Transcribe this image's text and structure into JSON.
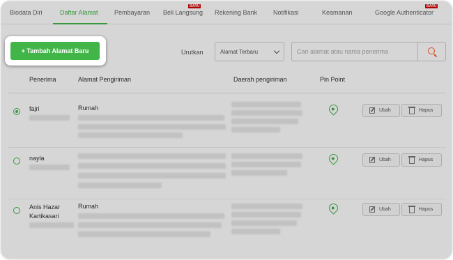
{
  "tabs": [
    {
      "label": "Biodata Diri",
      "active": false
    },
    {
      "label": "Daftar Alamat",
      "active": true
    },
    {
      "label": "Pembayaran",
      "active": false
    },
    {
      "label": "Beli Langsung",
      "active": false,
      "badge": "BARU"
    },
    {
      "label": "Rekening Bank",
      "active": false
    },
    {
      "label": "Notifikasi",
      "active": false
    },
    {
      "label": "Keamanan",
      "active": false
    },
    {
      "label": "Google Authenticator",
      "active": false,
      "badge": "BARU"
    }
  ],
  "toolbar": {
    "add_button_label": "+ Tambah Alamat Baru",
    "sort_label": "Urutkan",
    "sort_value": "Alamat Terbaru",
    "search_placeholder": "Cari alamat atau nama penerima"
  },
  "table": {
    "headers": [
      "Penerima",
      "Alamat Pengiriman",
      "Daerah pengiriman",
      "Pin Point"
    ],
    "rows": [
      {
        "name": "fajri",
        "address_label": "Rumah",
        "selected": true,
        "edit_label": "Ubah",
        "delete_label": "Hapus"
      },
      {
        "name": "nayla",
        "address_label": "",
        "selected": false,
        "edit_label": "Ubah",
        "delete_label": "Hapus"
      },
      {
        "name": "Anis Hazar Kartikasari",
        "address_label": "Rumah",
        "selected": false,
        "edit_label": "Ubah",
        "delete_label": "Hapus"
      }
    ]
  },
  "colors": {
    "accent": "#42b549",
    "badge": "#d50000",
    "search_icon": "#ff5722"
  },
  "icons": [
    "search-icon",
    "chevron-down-icon",
    "radio-icon",
    "map-pin-icon",
    "edit-icon",
    "trash-icon"
  ]
}
